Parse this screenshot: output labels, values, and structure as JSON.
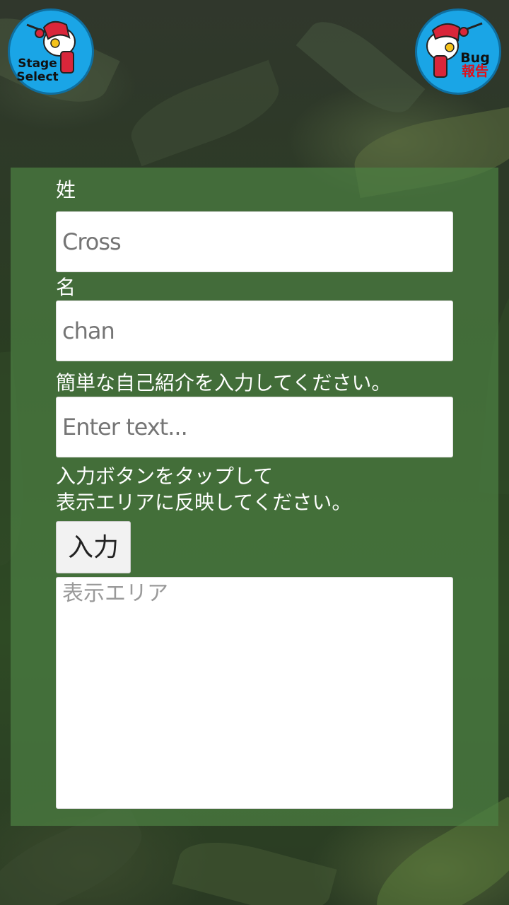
{
  "header": {
    "stage_select_line1": "Stage",
    "stage_select_line2": "Select",
    "bug_line1": "Bug",
    "bug_line2": "報告",
    "button_color": "#1aa5e6"
  },
  "form": {
    "last_name_label": "姓",
    "last_name_placeholder": "Cross",
    "first_name_label": "名",
    "first_name_placeholder": "chan",
    "intro_label": "簡単な自己紹介を入力してください。",
    "intro_placeholder": "Enter text...",
    "instruction_line1": "入力ボタンをタップして",
    "instruction_line2": "表示エリアに反映してください。",
    "enter_button": "入力",
    "display_area_placeholder": "表示エリア"
  }
}
